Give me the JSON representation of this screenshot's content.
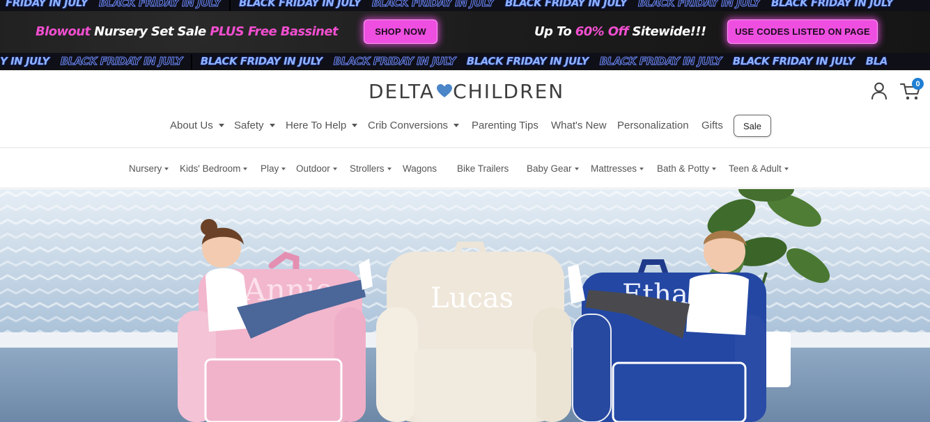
{
  "promo": {
    "ticker_text": "BLACK FRIDAY IN JULY",
    "ticker_partial_top": "FRIDAY IN JULY",
    "ticker_partial_bottom": "Y IN JULY",
    "ticker_partial_end": "BLA",
    "left_part1": "Blowout",
    "left_part2": " Nursery Set Sale ",
    "left_part3": "PLUS Free Bassinet",
    "shop_now": "SHOP NOW",
    "right_part1": "Up To ",
    "right_part2": "60% Off",
    "right_part3": " Sitewide!!!",
    "codes_btn": "USE CODES LISTED ON PAGE",
    "accent": "#ee4fe0",
    "ticker_color": "#8fb3ff"
  },
  "header": {
    "logo_part1": "DELTA",
    "logo_part2": "CHILDREN",
    "heart_color": "#4a86c8",
    "cart_count": "0",
    "account_icon": "user-icon",
    "cart_icon": "cart-icon"
  },
  "main_nav": {
    "items": [
      {
        "label": "About Us",
        "dropdown": true
      },
      {
        "label": "Safety",
        "dropdown": true
      },
      {
        "label": "Here To Help",
        "dropdown": true
      },
      {
        "label": "Crib Conversions",
        "dropdown": true
      },
      {
        "label": "Parenting Tips",
        "dropdown": false
      },
      {
        "label": "What's New",
        "dropdown": false
      },
      {
        "label": "Personalization",
        "dropdown": false
      },
      {
        "label": "Gifts",
        "dropdown": false
      }
    ],
    "sale": "Sale"
  },
  "category_nav": {
    "items": [
      {
        "label": "Nursery",
        "dropdown": true
      },
      {
        "label": "Kids' Bedroom",
        "dropdown": true
      },
      {
        "label": "Play",
        "dropdown": true
      },
      {
        "label": "Outdoor",
        "dropdown": true
      },
      {
        "label": "Strollers",
        "dropdown": true
      },
      {
        "label": "Wagons",
        "dropdown": false
      },
      {
        "label": "Bike Trailers",
        "dropdown": false
      },
      {
        "label": "Baby Gear",
        "dropdown": true
      },
      {
        "label": "Mattresses",
        "dropdown": true
      },
      {
        "label": "Bath & Potty",
        "dropdown": true
      },
      {
        "label": "Teen & Adult",
        "dropdown": true
      }
    ]
  },
  "hero": {
    "chair_left_name": "Annie",
    "chair_mid_name": "Lucas",
    "chair_right_name": "Ethan",
    "colors": {
      "pink_chair": "#f2b7cd",
      "cream_chair": "#efe7da",
      "blue_chair": "#2347a3"
    }
  }
}
